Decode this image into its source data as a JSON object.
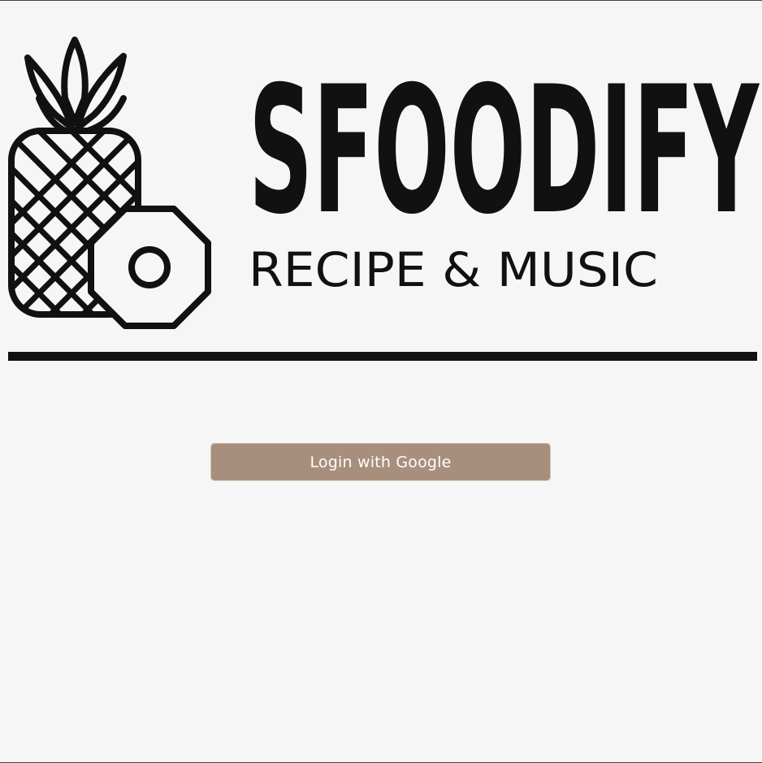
{
  "brand": {
    "title": "SFOODIFY",
    "tagline": "RECIPE & MUSIC",
    "logo_icon": "pineapple-icon"
  },
  "login": {
    "button_label": "Login with Google",
    "button_color": "#a88f7d"
  },
  "colors": {
    "background": "#f6f6f6",
    "ink": "#111111"
  }
}
